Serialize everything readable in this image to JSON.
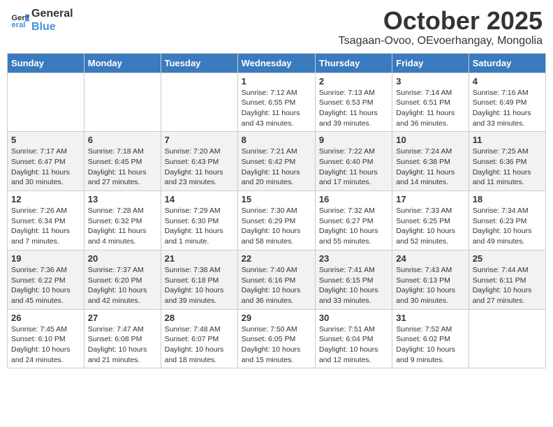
{
  "logo": {
    "line1": "General",
    "line2": "Blue"
  },
  "title": "October 2025",
  "location": "Tsagaan-Ovoo, OEvoerhangay, Mongolia",
  "weekdays": [
    "Sunday",
    "Monday",
    "Tuesday",
    "Wednesday",
    "Thursday",
    "Friday",
    "Saturday"
  ],
  "weeks": [
    [
      {
        "day": "",
        "info": ""
      },
      {
        "day": "",
        "info": ""
      },
      {
        "day": "",
        "info": ""
      },
      {
        "day": "1",
        "info": "Sunrise: 7:12 AM\nSunset: 6:55 PM\nDaylight: 11 hours and 43 minutes."
      },
      {
        "day": "2",
        "info": "Sunrise: 7:13 AM\nSunset: 6:53 PM\nDaylight: 11 hours and 39 minutes."
      },
      {
        "day": "3",
        "info": "Sunrise: 7:14 AM\nSunset: 6:51 PM\nDaylight: 11 hours and 36 minutes."
      },
      {
        "day": "4",
        "info": "Sunrise: 7:16 AM\nSunset: 6:49 PM\nDaylight: 11 hours and 33 minutes."
      }
    ],
    [
      {
        "day": "5",
        "info": "Sunrise: 7:17 AM\nSunset: 6:47 PM\nDaylight: 11 hours and 30 minutes."
      },
      {
        "day": "6",
        "info": "Sunrise: 7:18 AM\nSunset: 6:45 PM\nDaylight: 11 hours and 27 minutes."
      },
      {
        "day": "7",
        "info": "Sunrise: 7:20 AM\nSunset: 6:43 PM\nDaylight: 11 hours and 23 minutes."
      },
      {
        "day": "8",
        "info": "Sunrise: 7:21 AM\nSunset: 6:42 PM\nDaylight: 11 hours and 20 minutes."
      },
      {
        "day": "9",
        "info": "Sunrise: 7:22 AM\nSunset: 6:40 PM\nDaylight: 11 hours and 17 minutes."
      },
      {
        "day": "10",
        "info": "Sunrise: 7:24 AM\nSunset: 6:38 PM\nDaylight: 11 hours and 14 minutes."
      },
      {
        "day": "11",
        "info": "Sunrise: 7:25 AM\nSunset: 6:36 PM\nDaylight: 11 hours and 11 minutes."
      }
    ],
    [
      {
        "day": "12",
        "info": "Sunrise: 7:26 AM\nSunset: 6:34 PM\nDaylight: 11 hours and 7 minutes."
      },
      {
        "day": "13",
        "info": "Sunrise: 7:28 AM\nSunset: 6:32 PM\nDaylight: 11 hours and 4 minutes."
      },
      {
        "day": "14",
        "info": "Sunrise: 7:29 AM\nSunset: 6:30 PM\nDaylight: 11 hours and 1 minute."
      },
      {
        "day": "15",
        "info": "Sunrise: 7:30 AM\nSunset: 6:29 PM\nDaylight: 10 hours and 58 minutes."
      },
      {
        "day": "16",
        "info": "Sunrise: 7:32 AM\nSunset: 6:27 PM\nDaylight: 10 hours and 55 minutes."
      },
      {
        "day": "17",
        "info": "Sunrise: 7:33 AM\nSunset: 6:25 PM\nDaylight: 10 hours and 52 minutes."
      },
      {
        "day": "18",
        "info": "Sunrise: 7:34 AM\nSunset: 6:23 PM\nDaylight: 10 hours and 49 minutes."
      }
    ],
    [
      {
        "day": "19",
        "info": "Sunrise: 7:36 AM\nSunset: 6:22 PM\nDaylight: 10 hours and 45 minutes."
      },
      {
        "day": "20",
        "info": "Sunrise: 7:37 AM\nSunset: 6:20 PM\nDaylight: 10 hours and 42 minutes."
      },
      {
        "day": "21",
        "info": "Sunrise: 7:38 AM\nSunset: 6:18 PM\nDaylight: 10 hours and 39 minutes."
      },
      {
        "day": "22",
        "info": "Sunrise: 7:40 AM\nSunset: 6:16 PM\nDaylight: 10 hours and 36 minutes."
      },
      {
        "day": "23",
        "info": "Sunrise: 7:41 AM\nSunset: 6:15 PM\nDaylight: 10 hours and 33 minutes."
      },
      {
        "day": "24",
        "info": "Sunrise: 7:43 AM\nSunset: 6:13 PM\nDaylight: 10 hours and 30 minutes."
      },
      {
        "day": "25",
        "info": "Sunrise: 7:44 AM\nSunset: 6:11 PM\nDaylight: 10 hours and 27 minutes."
      }
    ],
    [
      {
        "day": "26",
        "info": "Sunrise: 7:45 AM\nSunset: 6:10 PM\nDaylight: 10 hours and 24 minutes."
      },
      {
        "day": "27",
        "info": "Sunrise: 7:47 AM\nSunset: 6:08 PM\nDaylight: 10 hours and 21 minutes."
      },
      {
        "day": "28",
        "info": "Sunrise: 7:48 AM\nSunset: 6:07 PM\nDaylight: 10 hours and 18 minutes."
      },
      {
        "day": "29",
        "info": "Sunrise: 7:50 AM\nSunset: 6:05 PM\nDaylight: 10 hours and 15 minutes."
      },
      {
        "day": "30",
        "info": "Sunrise: 7:51 AM\nSunset: 6:04 PM\nDaylight: 10 hours and 12 minutes."
      },
      {
        "day": "31",
        "info": "Sunrise: 7:52 AM\nSunset: 6:02 PM\nDaylight: 10 hours and 9 minutes."
      },
      {
        "day": "",
        "info": ""
      }
    ]
  ]
}
